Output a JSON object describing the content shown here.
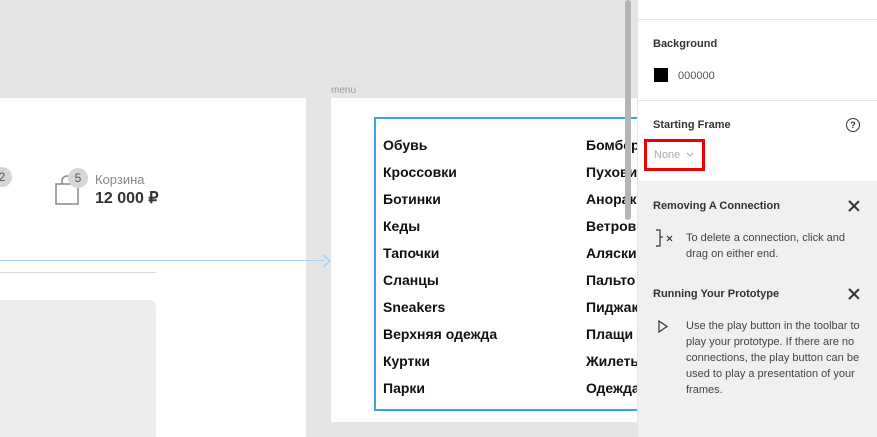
{
  "canvas": {
    "header": {
      "badge_count_partial": "2",
      "cart_badge_count": "5",
      "cart_label": "Корзина",
      "cart_price": "12 000 ₽"
    },
    "menu_frame": {
      "label": "menu",
      "column_a": [
        "Обувь",
        "Кроссовки",
        "Ботинки",
        "Кеды",
        "Тапочки",
        "Сланцы",
        "Sneakers",
        "Верхняя одежда",
        "Куртки",
        "Парки"
      ],
      "column_b": [
        "Бомбер",
        "Пуховик",
        "Анорак",
        "Ветровк",
        "Аляски",
        "Пальто",
        "Пиджак",
        "Плащи",
        "Жилеты",
        "Одежда"
      ]
    },
    "connection_color": "#a9d4f5",
    "selection_color": "#3aa3e3"
  },
  "panel": {
    "background": {
      "title": "Background",
      "hex": "000000",
      "swatch_color": "#000000"
    },
    "starting_frame": {
      "title": "Starting Frame",
      "value": "None",
      "help": "?"
    },
    "removing": {
      "title": "Removing A Connection",
      "text": "To delete a connection, click and drag on either end."
    },
    "running": {
      "title": "Running Your Prototype",
      "text": "Use the play button in the toolbar to play your prototype. If there are no connections, the play button can be used to play a presentation of your frames."
    }
  },
  "highlight_color": "#ee0000"
}
